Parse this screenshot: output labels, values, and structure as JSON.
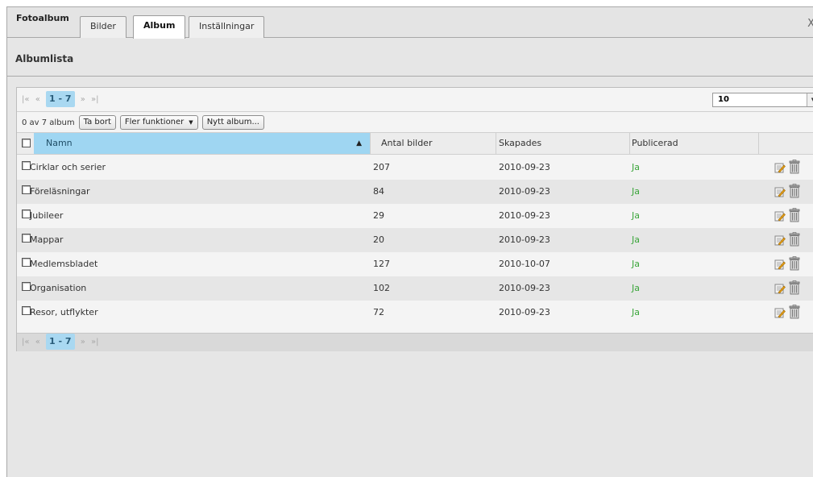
{
  "app": {
    "title": "Fotoalbum",
    "close_glyph": "X"
  },
  "tabs": [
    {
      "label": "Bilder",
      "active": false
    },
    {
      "label": "Album",
      "active": true
    },
    {
      "label": "Inställningar",
      "active": false
    }
  ],
  "section": {
    "title": "Albumlista"
  },
  "pager": {
    "first": "|«",
    "prev": "«",
    "current": "1 - 7",
    "next": "»",
    "last": "»|",
    "page_size": "10"
  },
  "toolbar": {
    "count_text": "0 av 7 album",
    "delete_label": "Ta bort",
    "more_label": "Fler funktioner",
    "new_label": "Nytt album..."
  },
  "table": {
    "headers": {
      "name": "Namn",
      "count": "Antal bilder",
      "created": "Skapades",
      "published": "Publicerad"
    },
    "rows": [
      {
        "name": "Cirklar och serier",
        "count": "207",
        "created": "2010-09-23",
        "published": "Ja"
      },
      {
        "name": "Föreläsningar",
        "count": "84",
        "created": "2010-09-23",
        "published": "Ja"
      },
      {
        "name": "Jubileer",
        "count": "29",
        "created": "2010-09-23",
        "published": "Ja"
      },
      {
        "name": "Mappar",
        "count": "20",
        "created": "2010-09-23",
        "published": "Ja"
      },
      {
        "name": "Medlemsbladet",
        "count": "127",
        "created": "2010-10-07",
        "published": "Ja"
      },
      {
        "name": "Organisation",
        "count": "102",
        "created": "2010-09-23",
        "published": "Ja"
      },
      {
        "name": "Resor, utflykter",
        "count": "72",
        "created": "2010-09-23",
        "published": "Ja"
      }
    ]
  },
  "icons": {
    "edit": "edit-icon",
    "delete": "trash-icon",
    "sort": "sort-asc-icon"
  },
  "colors": {
    "accent": "#9fd6f2",
    "published": "#3aa53a"
  }
}
